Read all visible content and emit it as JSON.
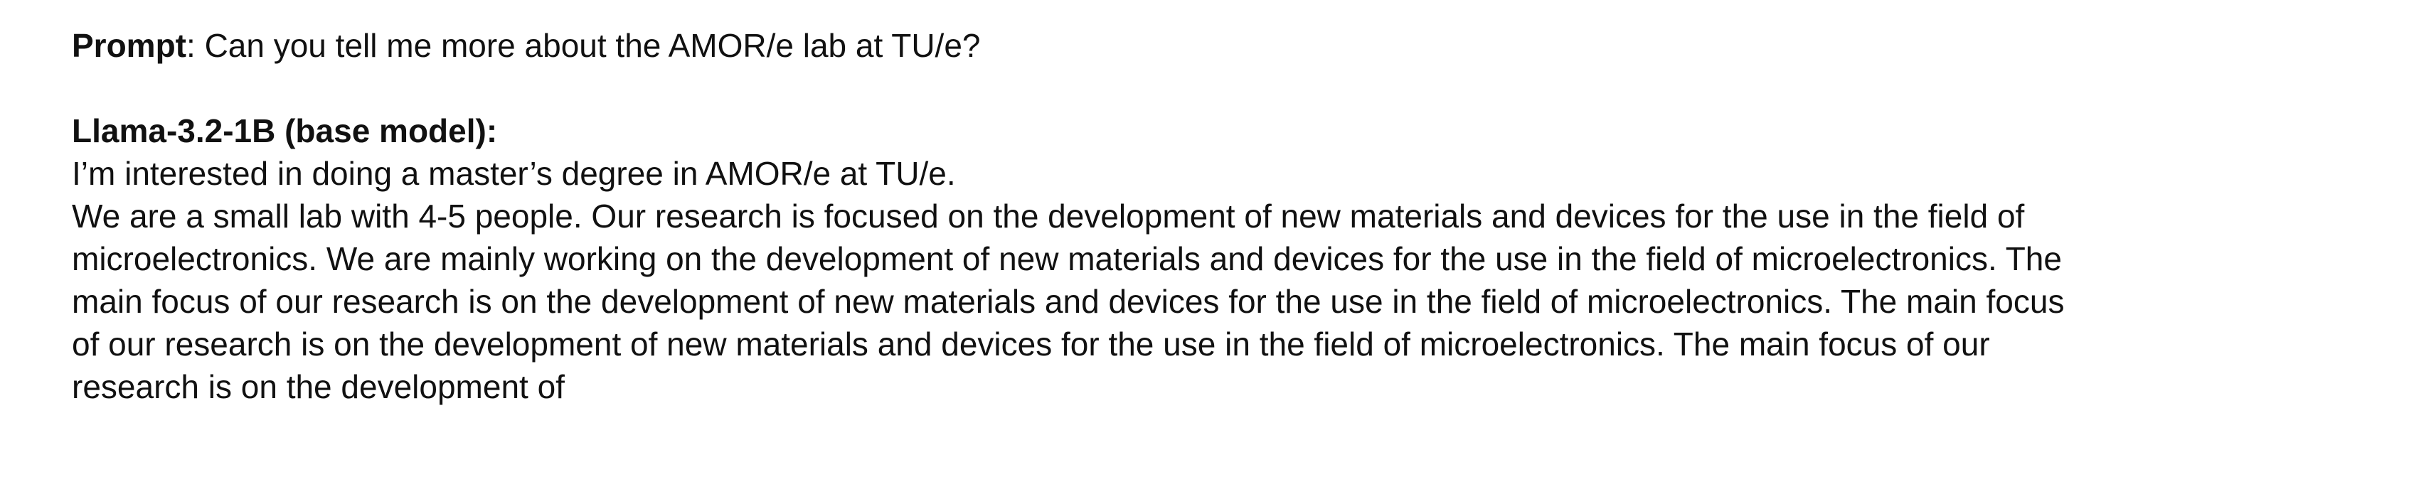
{
  "prompt": {
    "label": "Prompt",
    "separator": ": ",
    "text": "Can you tell me more about the AMOR/e lab at TU/e?"
  },
  "response": {
    "heading": "Llama-3.2-1B (base model):",
    "lines": [
      "I’m interested in doing a master’s degree in AMOR/e at TU/e.",
      "We are a small lab with 4-5 people. Our research is focused on the development of new materials and devices for the use in the field of",
      "microelectronics. We are mainly working on the development of new materials and devices for the use in the field of microelectronics. The",
      "main focus of our research is on the development of new materials and devices for the use in the field of microelectronics. The main focus",
      "of our research is on the development of new materials and devices for the use in the field of microelectronics. The main focus of our",
      "research is on the development of"
    ]
  }
}
